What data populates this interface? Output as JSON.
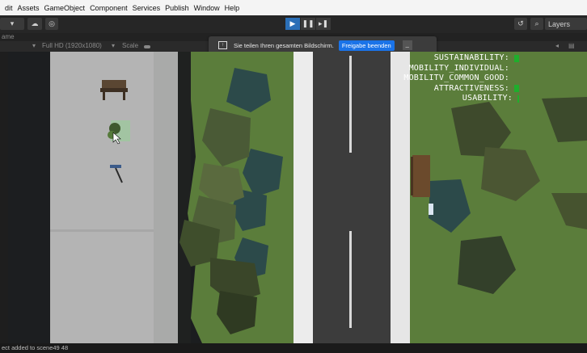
{
  "menu": [
    "dit",
    "Assets",
    "GameObject",
    "Component",
    "Services",
    "Publish",
    "Window",
    "Help"
  ],
  "toolbar": {
    "layers_label": "Layers"
  },
  "tab": {
    "label": "ame"
  },
  "gamebar": {
    "resolution": "Full HD (1920x1080)",
    "scale_label": "Scale"
  },
  "share_bar": {
    "message": "Sie teilen Ihren gesamten Bildschirm.",
    "stop_label": "Freigabe beenden"
  },
  "hud": {
    "rows": [
      {
        "label": "SUSTAINABILITY:",
        "level": 1.0
      },
      {
        "label": "MOBILITY_INDIVIDUAL:",
        "level": 0
      },
      {
        "label": "MOBILITV_COMMON_GOOD:",
        "level": 0
      },
      {
        "label": "ATTRACTIVENESS:",
        "level": 1.0
      },
      {
        "label": "USABILITY:",
        "level": 0.3
      }
    ],
    "bar_color": "#1fae2c"
  },
  "status": {
    "message": "ect added to scene49 48"
  },
  "colors": {
    "grass": "#5a7a3a",
    "sidewalk": "#b4b4b4",
    "road": "#3c3c3c",
    "accent": "#2b6fb7"
  }
}
